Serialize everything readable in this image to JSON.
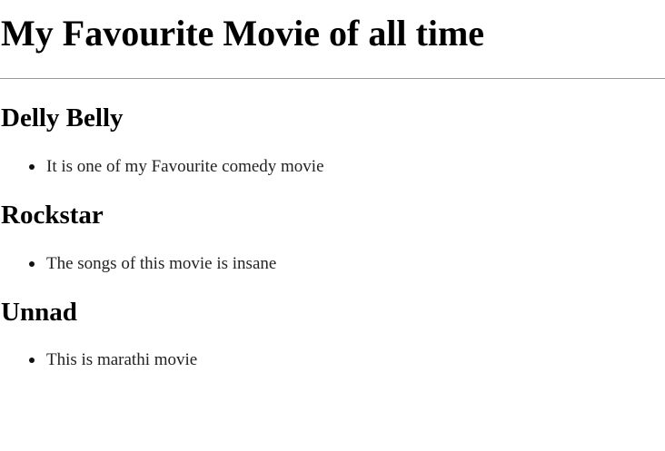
{
  "page": {
    "title": "My Favourite Movie of all time"
  },
  "movies": [
    {
      "title": "Delly Belly",
      "points": [
        "It is one of my Favourite comedy movie"
      ]
    },
    {
      "title": "Rockstar",
      "points": [
        "The songs of this movie is insane"
      ]
    },
    {
      "title": "Unnad",
      "points": [
        "This is marathi movie"
      ]
    }
  ]
}
